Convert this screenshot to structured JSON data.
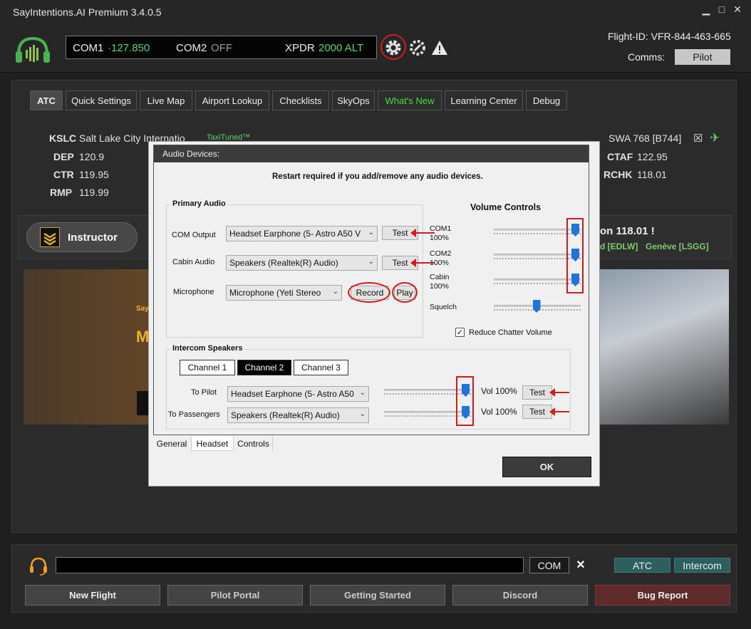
{
  "app": {
    "title": "SayIntentions.AI Premium  3.4.0.5"
  },
  "window": {
    "minimize": "▁",
    "maximize": "□",
    "close": "✕"
  },
  "radio": {
    "com1_label": "COM1",
    "com1_value": "·127.850",
    "com2_label": "COM2",
    "com2_value": "OFF",
    "xpdr_label": "XPDR",
    "xpdr_value": "2000 ALT"
  },
  "header": {
    "flight_id": "Flight-ID: VFR-844-463-665",
    "comms_label": "Comms:",
    "comms_value": "Pilot"
  },
  "tabs": [
    "ATC",
    "Quick Settings",
    "Live Map",
    "Airport Lookup",
    "Checklists",
    "SkyOps",
    "What's New",
    "Learning Center",
    "Debug"
  ],
  "info": {
    "airport_code": "KSLC",
    "airport_name": "Salt Lake City Internatio",
    "taxi_tuned": "TaxiTuned™",
    "dep_label": "DEP",
    "dep_value": "120.9",
    "ctr_label": "CTR",
    "ctr_value": "119.95",
    "rmp_label": "RMP",
    "rmp_value": "119.99",
    "callsign": "SWA 768 [B744]",
    "ctaf_label": "CTAF",
    "ctaf_value": "122.95",
    "rchk_label": "RCHK",
    "rchk_value": "118.01"
  },
  "instructor": {
    "label": "Instructor",
    "notice": "on 118.01 !",
    "airport1": "d [EDLW]",
    "airport2": "Genève [LSGG]"
  },
  "banner": {
    "letter": "M",
    "brand": "Sayl"
  },
  "dialog": {
    "title": "Audio Devices:",
    "notice": "Restart required if you add/remove any audio devices.",
    "primary_audio_label": "Primary Audio",
    "com_output_label": "COM Output",
    "com_output_value": "Headset Earphone (5- Astro A50 V",
    "cabin_audio_label": "Cabin Audio",
    "cabin_audio_value": "Speakers (Realtek(R) Audio)",
    "microphone_label": "Microphone",
    "microphone_value": "Microphone (Yeti Stereo",
    "test_label": "Test",
    "record_label": "Record",
    "play_label": "Play",
    "volume_controls_label": "Volume Controls",
    "com1_label": "COM1",
    "com1_value": "100%",
    "com2_label": "COM2",
    "com2_value": "100%",
    "cabin_label": "Cabin",
    "cabin_value": "100%",
    "squelch_label": "Squelch",
    "reduce_chatter_label": "Reduce Chatter Volume",
    "intercom_label": "Intercom Speakers",
    "channels": [
      "Channel 1",
      "Channel 2",
      "Channel 3"
    ],
    "to_pilot_label": "To Pilot",
    "to_pilot_value": "Headset Earphone (5- Astro A50",
    "to_passengers_label": "To Passengers",
    "to_passengers_value": "Speakers (Realtek(R) Audio)",
    "vol_pilot": "Vol 100%",
    "vol_passengers": "Vol 100%",
    "tabs": [
      "General",
      "Headset",
      "Controls"
    ],
    "ok_label": "OK",
    "levels": {
      "com1": 1.0,
      "com2": 1.0,
      "cabin": 1.0,
      "squelch": 0.5,
      "to_pilot": 1.0,
      "to_passengers": 1.0
    },
    "reduce_chatter_checked": true
  },
  "bottom": {
    "com_btn": "COM",
    "clear_btn": "✕",
    "atc_btn": "ATC",
    "intercom_btn": "Intercom",
    "buttons": [
      "New Flight",
      "Pilot Portal",
      "Getting Started",
      "Discord",
      "Bug Report"
    ]
  },
  "colors": {
    "accent_green": "#5fd36b",
    "alert_red": "#d21c1c",
    "slider_blue": "#1e74d8",
    "teal": "#2c6060",
    "bug_red": "#5e2a2a"
  }
}
